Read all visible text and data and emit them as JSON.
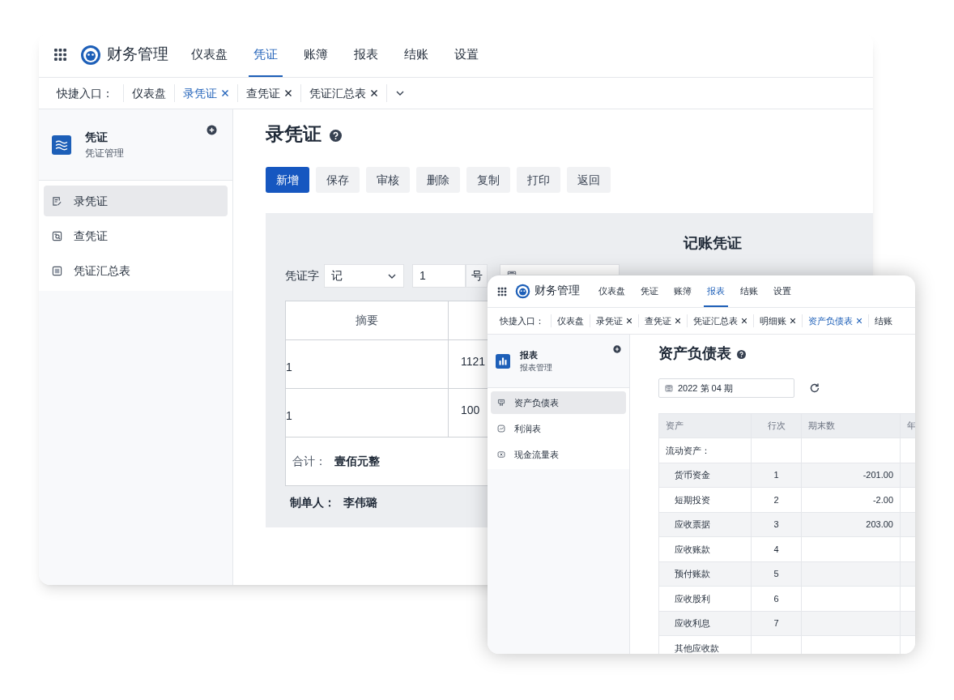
{
  "back_window": {
    "brand": "财务管理",
    "nav": [
      {
        "label": "仪表盘",
        "selected": false
      },
      {
        "label": "凭证",
        "selected": true
      },
      {
        "label": "账簿",
        "selected": false
      },
      {
        "label": "报表",
        "selected": false
      },
      {
        "label": "结账",
        "selected": false
      },
      {
        "label": "设置",
        "selected": false
      }
    ],
    "quick_label": "快捷入口：",
    "quick_tabs": [
      {
        "label": "仪表盘",
        "selected": false,
        "closable": false
      },
      {
        "label": "录凭证",
        "selected": true,
        "closable": true
      },
      {
        "label": "查凭证",
        "selected": false,
        "closable": true
      },
      {
        "label": "凭证汇总表",
        "selected": false,
        "closable": true
      }
    ],
    "sidebar": {
      "title": "凭证",
      "subtitle": "凭证管理",
      "items": [
        {
          "label": "录凭证",
          "selected": true,
          "kind": "edit"
        },
        {
          "label": "查凭证",
          "selected": false,
          "kind": "search"
        },
        {
          "label": "凭证汇总表",
          "selected": false,
          "kind": "table"
        }
      ]
    },
    "page_title": "录凭证",
    "toolbar": [
      {
        "label": "新增",
        "primary": true
      },
      {
        "label": "保存",
        "primary": false
      },
      {
        "label": "审核",
        "primary": false
      },
      {
        "label": "删除",
        "primary": false
      },
      {
        "label": "复制",
        "primary": false
      },
      {
        "label": "打印",
        "primary": false
      },
      {
        "label": "返回",
        "primary": false
      }
    ],
    "voucher": {
      "title": "记账凭证",
      "word_label": "凭证字",
      "word_value": "记",
      "number_value": "1",
      "number_suffix": "号",
      "columns": [
        "摘要"
      ],
      "rows": [
        {
          "summary": "1",
          "account": "1121"
        },
        {
          "summary": "1",
          "account": "100"
        }
      ],
      "total_label": "合计：",
      "total_value": "壹佰元整",
      "maker_label": "制单人：",
      "maker_value": "李伟璐"
    }
  },
  "front_window": {
    "brand": "财务管理",
    "nav": [
      {
        "label": "仪表盘",
        "selected": false
      },
      {
        "label": "凭证",
        "selected": false
      },
      {
        "label": "账簿",
        "selected": false
      },
      {
        "label": "报表",
        "selected": true
      },
      {
        "label": "结账",
        "selected": false
      },
      {
        "label": "设置",
        "selected": false
      }
    ],
    "quick_label": "快捷入口：",
    "quick_tabs": [
      {
        "label": "仪表盘",
        "selected": false,
        "closable": false
      },
      {
        "label": "录凭证",
        "selected": false,
        "closable": true
      },
      {
        "label": "查凭证",
        "selected": false,
        "closable": true
      },
      {
        "label": "凭证汇总表",
        "selected": false,
        "closable": true
      },
      {
        "label": "明细账",
        "selected": false,
        "closable": true
      },
      {
        "label": "资产负债表",
        "selected": true,
        "closable": true
      },
      {
        "label": "结账",
        "selected": false,
        "closable": false
      }
    ],
    "sidebar": {
      "title": "报表",
      "subtitle": "报表管理",
      "items": [
        {
          "label": "资产负债表",
          "selected": true,
          "kind": "balance"
        },
        {
          "label": "利润表",
          "selected": false,
          "kind": "chart"
        },
        {
          "label": "现金流量表",
          "selected": false,
          "kind": "cash"
        }
      ]
    },
    "page_title": "资产负债表",
    "period": "2022 第 04 期",
    "columns": [
      "资产",
      "行次",
      "期末数",
      "年"
    ],
    "rows": [
      {
        "kind": "group",
        "asset": "流动资产："
      },
      {
        "kind": "item",
        "asset": "货币资金",
        "line": "1",
        "end_value": "-201.00"
      },
      {
        "kind": "item",
        "asset": "短期投资",
        "line": "2",
        "end_value": "-2.00"
      },
      {
        "kind": "item",
        "asset": "应收票据",
        "line": "3",
        "end_value": "203.00"
      },
      {
        "kind": "item",
        "asset": "应收账款",
        "line": "4"
      },
      {
        "kind": "item",
        "asset": "预付账款",
        "line": "5"
      },
      {
        "kind": "item",
        "asset": "应收股利",
        "line": "6"
      },
      {
        "kind": "item",
        "asset": "应收利息",
        "line": "7"
      },
      {
        "kind": "item",
        "asset": "其他应收款"
      }
    ]
  }
}
